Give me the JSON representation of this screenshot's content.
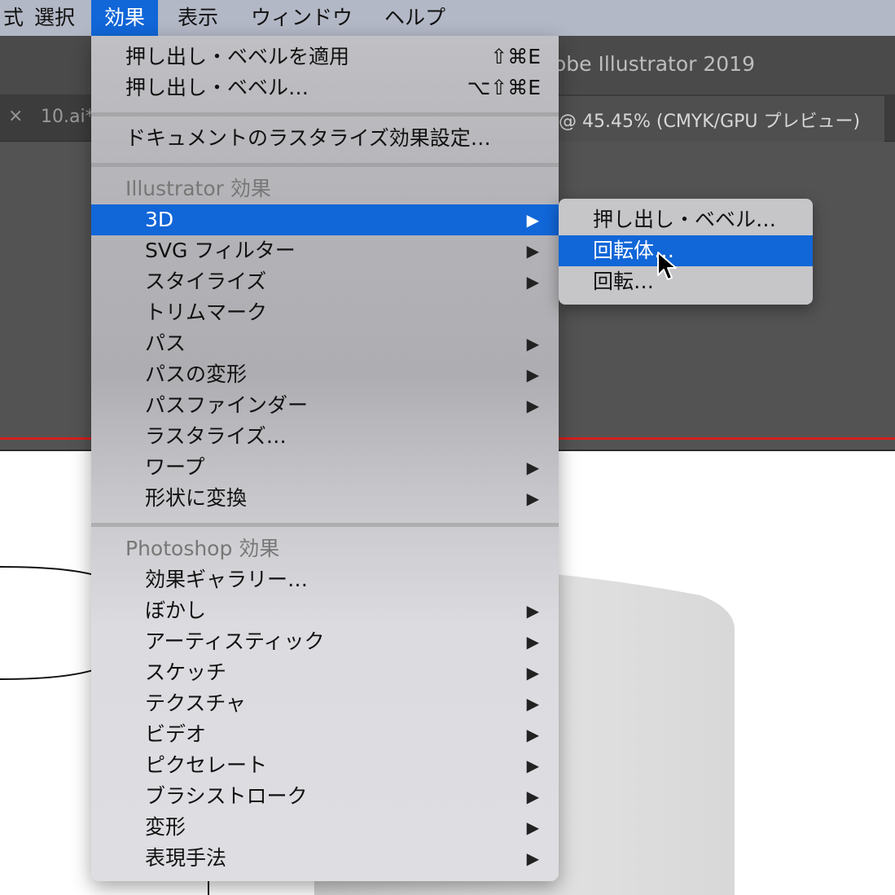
{
  "menubar": {
    "items": [
      {
        "label": "式"
      },
      {
        "label": "選択"
      },
      {
        "label": "効果"
      },
      {
        "label": "表示"
      },
      {
        "label": "ウィンドウ"
      },
      {
        "label": "ヘルプ"
      }
    ]
  },
  "window": {
    "title": "obe Illustrator 2019",
    "tab_close": "×",
    "tab_left_label": "10.ai*",
    "tab_right_label": "@ 45.45% (CMYK/GPU プレビュー)"
  },
  "menu": {
    "extrude_apply": {
      "label": "押し出し・ベベルを適用",
      "shortcut": "⇧⌘E"
    },
    "extrude": {
      "label": "押し出し・ベベル…",
      "shortcut": "⌥⇧⌘E"
    },
    "raster_settings": "ドキュメントのラスタライズ効果設定…",
    "illustrator_header": "Illustrator 効果",
    "illustrator_items": [
      {
        "label": "3D",
        "arrow": "▶"
      },
      {
        "label": "SVG フィルター",
        "arrow": "▶"
      },
      {
        "label": "スタイライズ",
        "arrow": "▶"
      },
      {
        "label": "トリムマーク",
        "arrow": ""
      },
      {
        "label": "パス",
        "arrow": "▶"
      },
      {
        "label": "パスの変形",
        "arrow": "▶"
      },
      {
        "label": "パスファインダー",
        "arrow": "▶"
      },
      {
        "label": "ラスタライズ…",
        "arrow": ""
      },
      {
        "label": "ワープ",
        "arrow": "▶"
      },
      {
        "label": "形状に変換",
        "arrow": "▶"
      }
    ],
    "photoshop_header": "Photoshop 効果",
    "photoshop_items": [
      {
        "label": "効果ギャラリー…",
        "arrow": ""
      },
      {
        "label": "ぼかし",
        "arrow": "▶"
      },
      {
        "label": "アーティスティック",
        "arrow": "▶"
      },
      {
        "label": "スケッチ",
        "arrow": "▶"
      },
      {
        "label": "テクスチャ",
        "arrow": "▶"
      },
      {
        "label": "ビデオ",
        "arrow": "▶"
      },
      {
        "label": "ピクセレート",
        "arrow": "▶"
      },
      {
        "label": "ブラシストローク",
        "arrow": "▶"
      },
      {
        "label": "変形",
        "arrow": "▶"
      },
      {
        "label": "表現手法",
        "arrow": "▶"
      }
    ]
  },
  "submenu": {
    "items": [
      {
        "label": "押し出し・ベベル…"
      },
      {
        "label": "回転体…"
      },
      {
        "label": "回転…"
      }
    ]
  },
  "colors": {
    "accent": "#1166d8",
    "menubar": "#b3b8c6",
    "chrome": "#535353"
  }
}
